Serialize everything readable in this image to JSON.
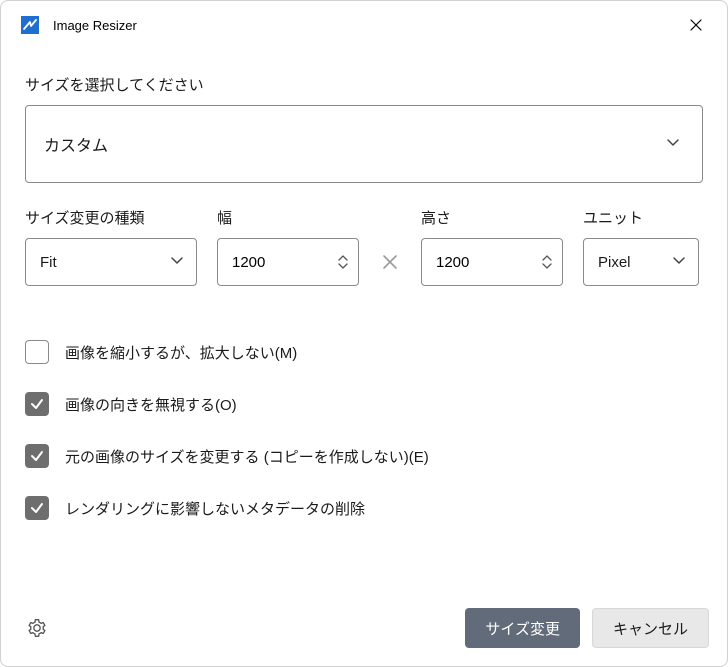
{
  "window": {
    "title": "Image Resizer"
  },
  "sizeSection": {
    "label": "サイズを選択してください",
    "selected": "カスタム"
  },
  "params": {
    "resizeType": {
      "label": "サイズ変更の種類",
      "value": "Fit"
    },
    "width": {
      "label": "幅",
      "value": "1200"
    },
    "height": {
      "label": "高さ",
      "value": "1200"
    },
    "unit": {
      "label": "ユニット",
      "value": "Pixel"
    }
  },
  "checkboxes": [
    {
      "label": "画像を縮小するが、拡大しない(M)",
      "checked": false
    },
    {
      "label": "画像の向きを無視する(O)",
      "checked": true
    },
    {
      "label": "元の画像のサイズを変更する (コピーを作成しない)(E)",
      "checked": true
    },
    {
      "label": "レンダリングに影響しないメタデータの削除",
      "checked": true
    }
  ],
  "footer": {
    "resize": "サイズ変更",
    "cancel": "キャンセル"
  }
}
